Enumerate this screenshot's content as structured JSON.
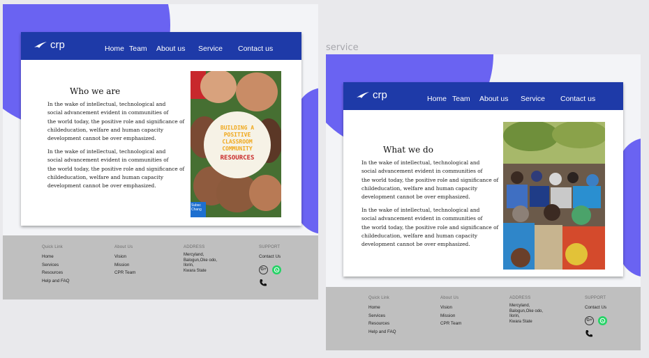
{
  "frames": [
    {
      "label": "",
      "logo_text": "crp",
      "nav": [
        "Home",
        "Team",
        "About us",
        "Service",
        "Contact us"
      ],
      "heading": "Who we are",
      "paragraph1": "In the wake of intellectual, technological and\nsocial  advancement evident in communities of\nthe world today, the positive role and significance of\nchildeducation, welfare and human capacity\ndevelopment cannot be over emphasized.",
      "paragraph2": "In the wake of intellectual, technological and\nsocial  advancement evident in communities of\nthe world today, the positive role and significance of\nchildeducation, welfare and human capacity\ndevelopment cannot be over emphasized.",
      "poster": {
        "line1": "BUILDING A",
        "line2": "POSITIVE",
        "line3": "CLASSROOM",
        "line4": "COMMUNITY",
        "line5": "RESOURCES",
        "corner": "Subsc\nChang"
      }
    },
    {
      "label": "service",
      "logo_text": "crp",
      "nav": [
        "Home",
        "Team",
        "About us",
        "Service",
        "Contact us"
      ],
      "heading": "What we do",
      "paragraph1": "In the wake of intellectual, technological and\nsocial  advancement evident in communities of\nthe world today, the positive role and significance of\nchildeducation, welfare and human capacity\ndevelopment cannot be over emphasized.",
      "paragraph2": "In the wake of intellectual, technological and\nsocial  advancement evident in communities of\nthe world today, the positive role and significance of\nchildeducation, welfare and human capacity\ndevelopment cannot be over emphasized."
    }
  ],
  "footer": {
    "quick_link_title": "Quick Link",
    "quick_links": [
      "Home",
      "Services",
      "Resources",
      "Help and FAQ"
    ],
    "about_title": "About Us",
    "about_links": [
      "Vision",
      "Mission",
      "CPR Team"
    ],
    "address_title": "ADDRESS",
    "address_lines": [
      "Mercyland,",
      "Balogun,Oke odo,",
      "Ilorin,",
      "Kwara State"
    ],
    "support_title": "SUPPORT",
    "support_contact": "Contact Us"
  },
  "icons": [
    "google-plus-icon",
    "whatsapp-icon",
    "phone-icon",
    "crp-logo-icon"
  ],
  "colors": {
    "nav_blue": "#1e3aa8",
    "accent_purple": "#6a63f2",
    "footer_grey": "#bfbfbf",
    "whatsapp_green": "#25d366"
  }
}
